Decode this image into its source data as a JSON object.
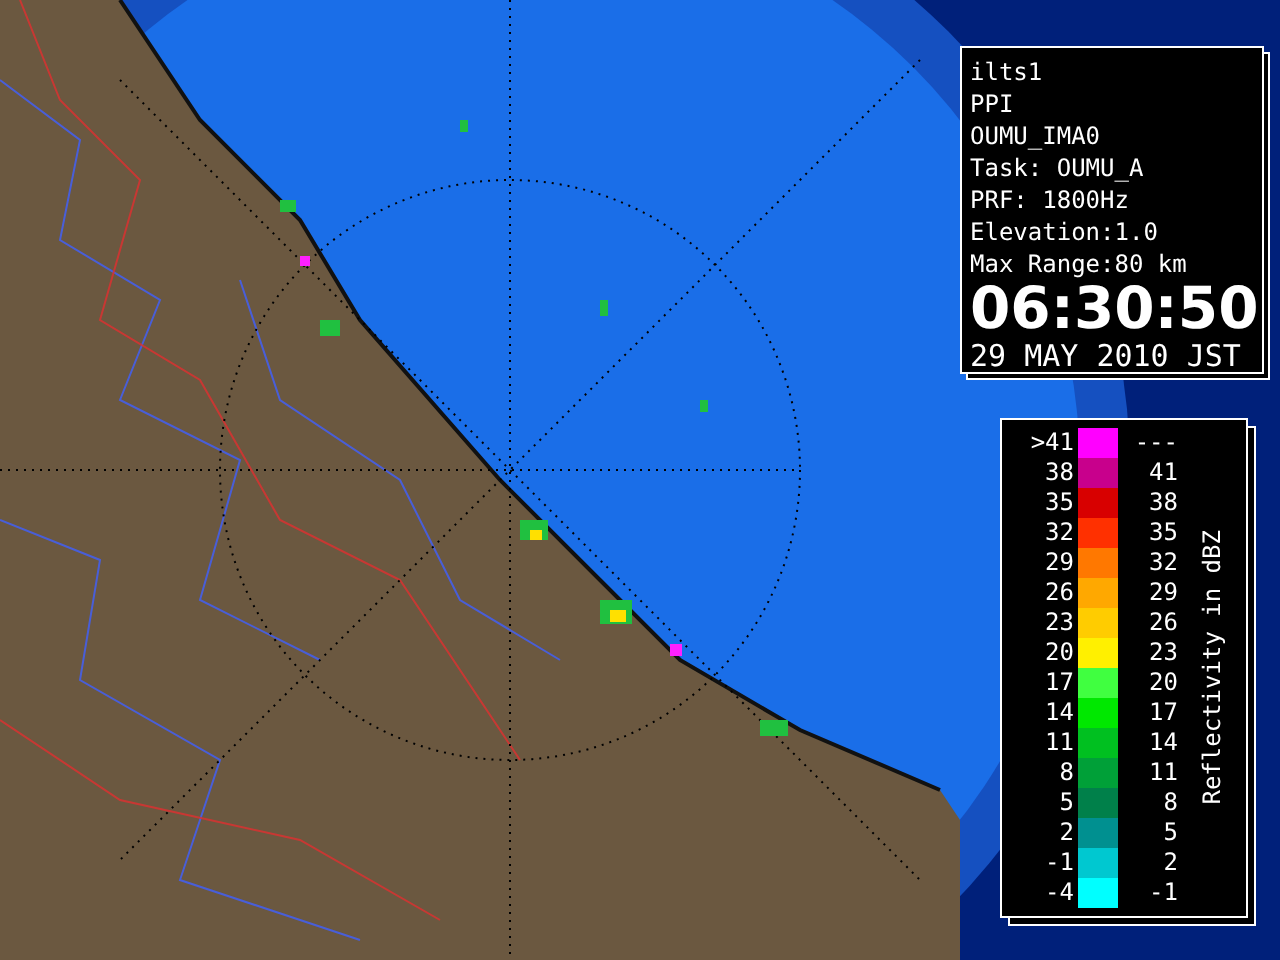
{
  "info_panel": {
    "lines": [
      "ilts1",
      "PPI",
      "OUMU_IMA0",
      "Task: OUMU_A",
      "PRF: 1800Hz",
      "Elevation:1.0",
      "Max Range:80 km"
    ],
    "time": "06:30:50",
    "date": "29 MAY 2010 JST"
  },
  "legend": {
    "title": "Reflectivity in dBZ",
    "rows": [
      {
        "low": ">41",
        "high": "---",
        "color": "#ff00ff"
      },
      {
        "low": "38",
        "high": "41",
        "color": "#c8008c"
      },
      {
        "low": "35",
        "high": "38",
        "color": "#d80000"
      },
      {
        "low": "32",
        "high": "35",
        "color": "#ff3000"
      },
      {
        "low": "29",
        "high": "32",
        "color": "#ff7800"
      },
      {
        "low": "26",
        "high": "29",
        "color": "#ffa800"
      },
      {
        "low": "23",
        "high": "26",
        "color": "#ffcc00"
      },
      {
        "low": "20",
        "high": "23",
        "color": "#fff000"
      },
      {
        "low": "17",
        "high": "20",
        "color": "#40ff40"
      },
      {
        "low": "14",
        "high": "17",
        "color": "#00e800"
      },
      {
        "low": "11",
        "high": "14",
        "color": "#00c020"
      },
      {
        "low": "8",
        "high": "11",
        "color": "#00a038"
      },
      {
        "low": "5",
        "high": "8",
        "color": "#00804a"
      },
      {
        "low": "2",
        "high": "5",
        "color": "#009090"
      },
      {
        "low": "-1",
        "high": "2",
        "color": "#00c8d0"
      },
      {
        "low": "-4",
        "high": "-1",
        "color": "#00ffff"
      }
    ]
  }
}
